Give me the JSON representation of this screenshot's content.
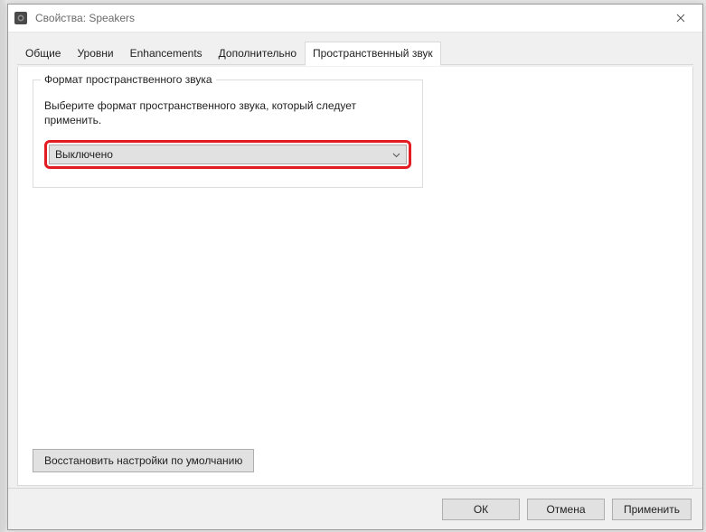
{
  "window": {
    "title": "Свойства: Speakers"
  },
  "tabs": {
    "t0": "Общие",
    "t1": "Уровни",
    "t2": "Enhancements",
    "t3": "Дополнительно",
    "t4": "Пространственный звук"
  },
  "group": {
    "legend": "Формат пространственного звука",
    "desc": "Выберите формат пространственного звука, который следует применить.",
    "selected": "Выключено"
  },
  "buttons": {
    "restore": "Восстановить настройки по умолчанию",
    "ok": "ОК",
    "cancel": "Отмена",
    "apply": "Применить"
  }
}
